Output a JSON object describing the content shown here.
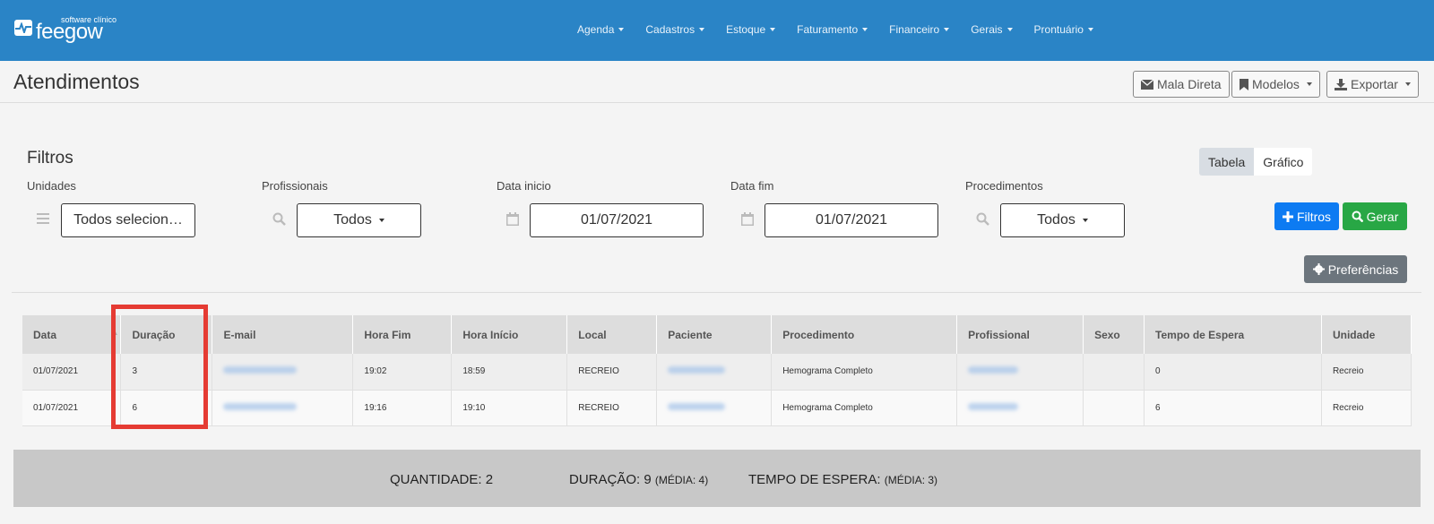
{
  "brand": {
    "tagline": "software clínico",
    "name": "feegow"
  },
  "nav": [
    {
      "label": "Agenda"
    },
    {
      "label": "Cadastros"
    },
    {
      "label": "Estoque"
    },
    {
      "label": "Faturamento"
    },
    {
      "label": "Financeiro"
    },
    {
      "label": "Gerais"
    },
    {
      "label": "Prontuário"
    }
  ],
  "page": {
    "title": "Atendimentos"
  },
  "header_buttons": {
    "mala_direta": "Mala Direta",
    "modelos": "Modelos",
    "exportar": "Exportar"
  },
  "filters": {
    "title": "Filtros",
    "unidades": {
      "label": "Unidades",
      "value": "Todos selecion…"
    },
    "profissionais": {
      "label": "Profissionais",
      "value": "Todos"
    },
    "data_inicio": {
      "label": "Data inicio",
      "value": "01/07/2021"
    },
    "data_fim": {
      "label": "Data fim",
      "value": "01/07/2021"
    },
    "procedimentos": {
      "label": "Procedimentos",
      "value": "Todos"
    }
  },
  "view_toggle": {
    "tabela": "Tabela",
    "grafico": "Gráfico",
    "selected": "Tabela"
  },
  "actions": {
    "filtros": "Filtros",
    "gerar": "Gerar",
    "preferencias": "Preferências"
  },
  "table": {
    "columns": [
      "Data",
      "Duração",
      "E-mail",
      "Hora Fim",
      "Hora Início",
      "Local",
      "Paciente",
      "Procedimento",
      "Profissional",
      "Sexo",
      "Tempo de Espera",
      "Unidade"
    ],
    "rows": [
      {
        "data": "01/07/2021",
        "duracao": "3",
        "hora_fim": "19:02",
        "hora_inicio": "18:59",
        "local": "RECREIO",
        "procedimento": "Hemograma Completo",
        "sexo": "",
        "tempo_espera": "0",
        "unidade": "Recreio"
      },
      {
        "data": "01/07/2021",
        "duracao": "6",
        "hora_fim": "19:16",
        "hora_inicio": "19:10",
        "local": "RECREIO",
        "procedimento": "Hemograma Completo",
        "sexo": "",
        "tempo_espera": "6",
        "unidade": "Recreio"
      }
    ]
  },
  "summary": {
    "quantidade_label": "QUANTIDADE:",
    "quantidade": "2",
    "duracao_label": "DURAÇÃO:",
    "duracao": "9",
    "duracao_media": "(MÉDIA: 4)",
    "espera_label": "TEMPO DE ESPERA:",
    "espera_media": "(MÉDIA: 3)"
  },
  "colors": {
    "topbar": "#2a84c6",
    "highlight": "#e53b33",
    "primary": "#0d7bf2",
    "success": "#28a745",
    "link": "#2a7bd3"
  }
}
